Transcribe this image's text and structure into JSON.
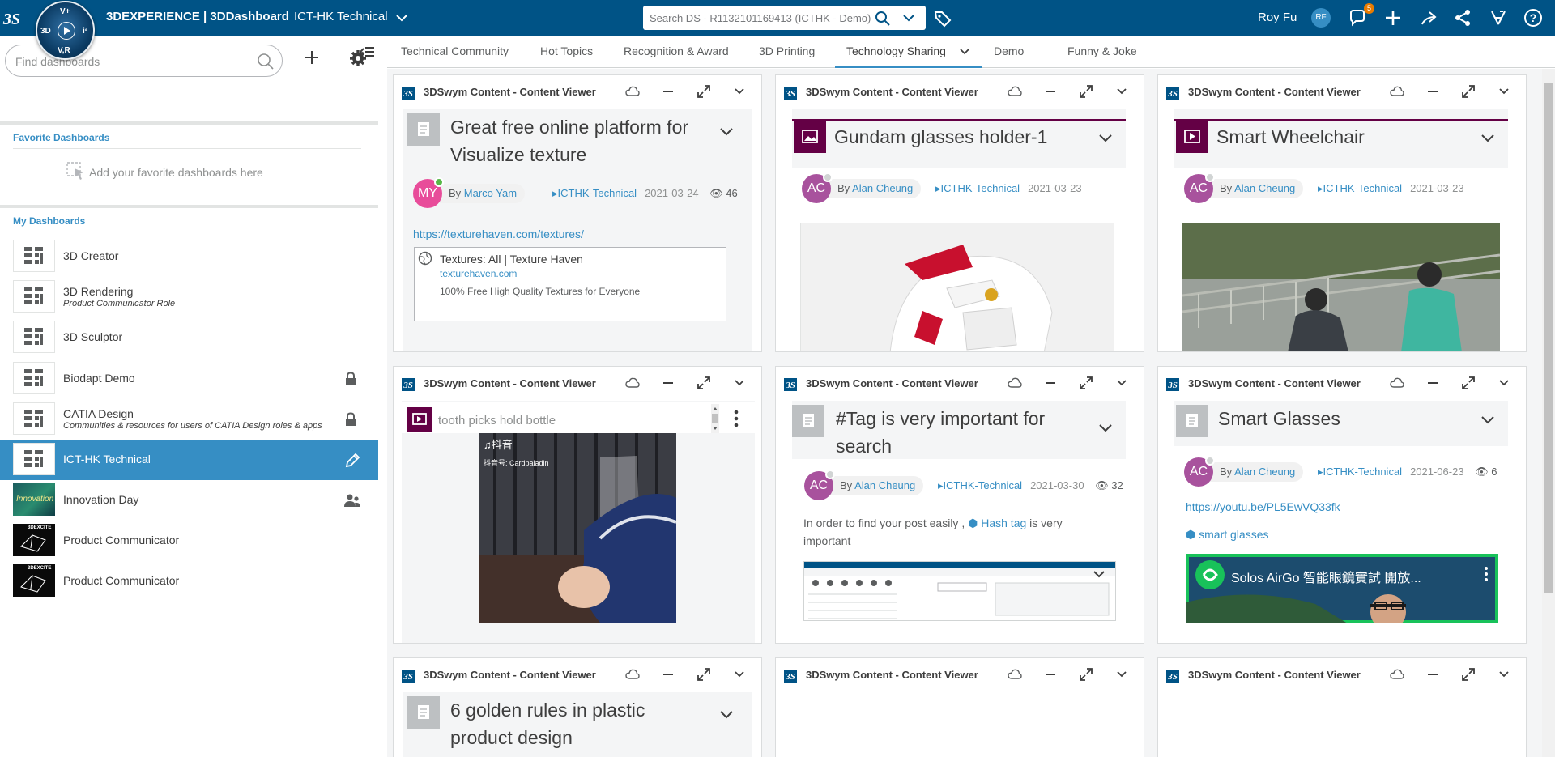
{
  "topbar": {
    "brand": "3DEXPERIENCE | 3DDashboard",
    "context": "ICT-HK Technical",
    "compass": {
      "top": "V+",
      "left": "3D",
      "right": "i²",
      "bottom": "V,R"
    },
    "search_placeholder": "Search DS - R1132101169413 (ICTHK - Demo)",
    "user_name": "Roy Fu",
    "user_initials": "RF",
    "notification_count": "5"
  },
  "sidebar": {
    "search_placeholder": "Find dashboards",
    "favorites_heading": "Favorite Dashboards",
    "favorites_empty": "Add your favorite dashboards here",
    "my_heading": "My Dashboards",
    "items": [
      {
        "name": "3D Creator",
        "sub": ""
      },
      {
        "name": "3D Rendering",
        "sub": "Product Communicator Role"
      },
      {
        "name": "3D Sculptor",
        "sub": ""
      },
      {
        "name": "Biodapt Demo",
        "sub": ""
      },
      {
        "name": "CATIA Design",
        "sub": "Communities & resources for users of CATIA Design roles & apps"
      },
      {
        "name": "ICT-HK Technical",
        "sub": ""
      },
      {
        "name": "Innovation Day",
        "sub": ""
      },
      {
        "name": "Product Communicator",
        "sub": ""
      },
      {
        "name": "Product Communicator",
        "sub": ""
      }
    ],
    "thumb_labels": {
      "innovation": "Innovation",
      "prod1": "3DEXCITE",
      "prod2": "3DEXCITE"
    }
  },
  "tabs": [
    "Technical Community",
    "Hot Topics",
    "Recognition & Award",
    "3D Printing",
    "Technology Sharing",
    "Demo",
    "Funny & Joke"
  ],
  "widget_title": "3DSwym Content - Content Viewer",
  "posts": {
    "p1": {
      "title": "Great free online platform for Visualize texture",
      "initials": "MY",
      "author": "Marco Yam",
      "community": "ICTHK-Technical",
      "date": "2021-03-24",
      "views": "46",
      "url": "https://texturehaven.com/textures/",
      "preview_title": "Textures: All | Texture Haven",
      "preview_domain": "texturehaven.com",
      "preview_desc": "100% Free High Quality Textures for Everyone"
    },
    "p2": {
      "title": "Gundam glasses holder-1",
      "initials": "AC",
      "author": "Alan Cheung",
      "community": "ICTHK-Technical",
      "date": "2021-03-23"
    },
    "p3": {
      "title": "Smart Wheelchair",
      "initials": "AC",
      "author": "Alan Cheung",
      "community": "ICTHK-Technical",
      "date": "2021-03-23"
    },
    "p4": {
      "title": "tooth picks hold bottle",
      "video_brand": "抖音",
      "video_id": "抖音号: Cardpaladin"
    },
    "p5": {
      "title": "#Tag is very important for search",
      "initials": "AC",
      "author": "Alan Cheung",
      "community": "ICTHK-Technical",
      "date": "2021-03-30",
      "views": "32",
      "body_pre": "In order to find your post easily ,",
      "body_tag": "Hash tag",
      "body_post": "is very important"
    },
    "p6": {
      "title": "Smart Glasses",
      "initials": "AC",
      "author": "Alan Cheung",
      "community": "ICTHK-Technical",
      "date": "2021-06-23",
      "views": "6",
      "url": "https://youtu.be/PL5EwVQ33fk",
      "tag": "smart glasses",
      "video_title": "Solos AirGo 智能眼鏡實試 開放..."
    },
    "p7": {
      "title": "6 golden rules in plastic product design"
    }
  },
  "colors": {
    "topbar": "#005386",
    "accent": "#368ec4",
    "active_item": "#368ec4",
    "purple": "#640045",
    "my_avatar": "#e84c9a",
    "ac_avatar": "#a8529d"
  }
}
